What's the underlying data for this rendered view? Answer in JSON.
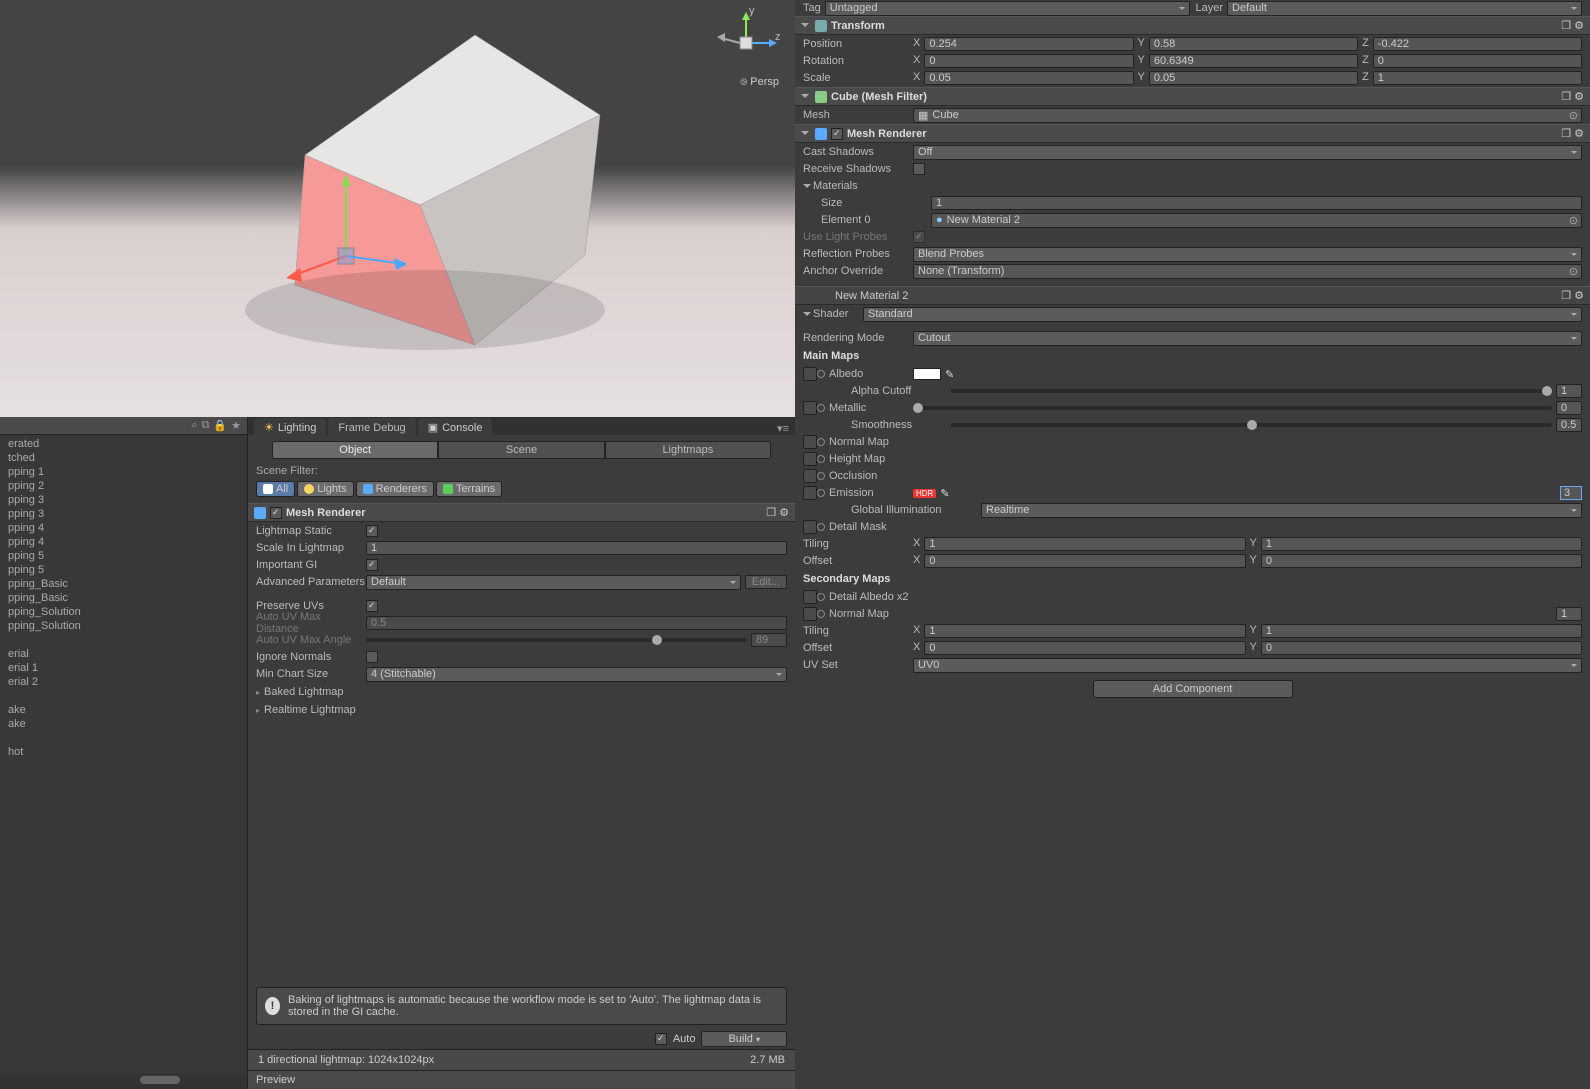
{
  "scene": {
    "persp": "Persp"
  },
  "hierarchy": {
    "items": [
      "erated",
      "tched",
      "pping 1",
      "pping 2",
      "pping 3",
      "pping 3",
      "pping 4",
      "pping 4",
      "pping 5",
      "pping 5",
      "pping_Basic",
      "pping_Basic",
      "pping_Solution",
      "pping_Solution",
      "",
      "erial",
      "erial 1",
      "erial 2",
      "",
      "ake",
      "ake",
      "",
      "hot"
    ]
  },
  "tabs": {
    "lighting": "Lighting",
    "frameDebug": "Frame Debug",
    "console": "Console"
  },
  "subtabs": {
    "object": "Object",
    "scene": "Scene",
    "lightmaps": "Lightmaps"
  },
  "sceneFilter": {
    "label": "Scene Filter:",
    "all": "All",
    "lights": "Lights",
    "renderers": "Renderers",
    "terrains": "Terrains"
  },
  "meshRenderer": {
    "title": "Mesh Renderer",
    "lightmapStatic": "Lightmap Static",
    "scaleInLightmap": "Scale In Lightmap",
    "scaleVal": "1",
    "importantGI": "Important GI",
    "advancedParams": "Advanced Parameters",
    "advVal": "Default",
    "editBtn": "Edit...",
    "preserveUVs": "Preserve UVs",
    "autoUVMaxDist": "Auto UV Max Distance",
    "autoDistVal": "0.5",
    "autoUVMaxAngle": "Auto UV Max Angle",
    "autoAngleVal": "89",
    "ignoreNormals": "Ignore Normals",
    "minChartSize": "Min Chart Size",
    "minChartVal": "4 (Stitchable)",
    "bakedLM": "Baked Lightmap",
    "realtimeLM": "Realtime Lightmap"
  },
  "info": "Baking of lightmaps is automatic because the workflow mode is set to 'Auto'. The lightmap data is stored in the GI cache.",
  "auto": "Auto",
  "build": "Build",
  "status": {
    "left": "1 directional lightmap: 1024x1024px",
    "right": "2.7 MB"
  },
  "preview": "Preview",
  "inspector": {
    "tag": "Tag",
    "tagVal": "Untagged",
    "layer": "Layer",
    "layerVal": "Default",
    "transform": {
      "title": "Transform",
      "position": "Position",
      "px": "0.254",
      "py": "0.58",
      "pz": "-0.422",
      "rotation": "Rotation",
      "rx": "0",
      "ry": "60.6349",
      "rz": "0",
      "scale": "Scale",
      "sx": "0.05",
      "sy": "0.05",
      "sz": "1"
    },
    "meshFilter": {
      "title": "Cube (Mesh Filter)",
      "mesh": "Mesh",
      "meshVal": "Cube"
    },
    "meshRenderer": {
      "title": "Mesh Renderer",
      "castShadows": "Cast Shadows",
      "castVal": "Off",
      "receiveShadows": "Receive Shadows",
      "materials": "Materials",
      "size": "Size",
      "sizeVal": "1",
      "element0": "Element 0",
      "elemVal": "New Material 2",
      "useLightProbes": "Use Light Probes",
      "reflectionProbes": "Reflection Probes",
      "reflVal": "Blend Probes",
      "anchorOverride": "Anchor Override",
      "anchorVal": "None (Transform)"
    },
    "material": {
      "name": "New Material 2",
      "shader": "Shader",
      "shaderVal": "Standard",
      "renderingMode": "Rendering Mode",
      "renderingVal": "Cutout",
      "mainMaps": "Main Maps",
      "albedo": "Albedo",
      "alphaCutoff": "Alpha Cutoff",
      "alphaVal": "1",
      "metallic": "Metallic",
      "metallicVal": "0",
      "smoothness": "Smoothness",
      "smoothVal": "0.5",
      "normalMap": "Normal Map",
      "heightMap": "Height Map",
      "occlusion": "Occlusion",
      "emission": "Emission",
      "hdr": "HDR",
      "emVal": "3",
      "globalIllum": "Global Illumination",
      "globalVal": "Realtime",
      "detailMask": "Detail Mask",
      "tiling": "Tiling",
      "offset": "Offset",
      "tx": "1",
      "ty": "1",
      "ox": "0",
      "oy": "0",
      "secondaryMaps": "Secondary Maps",
      "detailAlbedo": "Detail Albedo x2",
      "normalMap2": "Normal Map",
      "nm2Val": "1",
      "tx2": "1",
      "ty2": "1",
      "ox2": "0",
      "oy2": "0",
      "uvSet": "UV Set",
      "uvVal": "UV0"
    },
    "addComponent": "Add Component"
  }
}
